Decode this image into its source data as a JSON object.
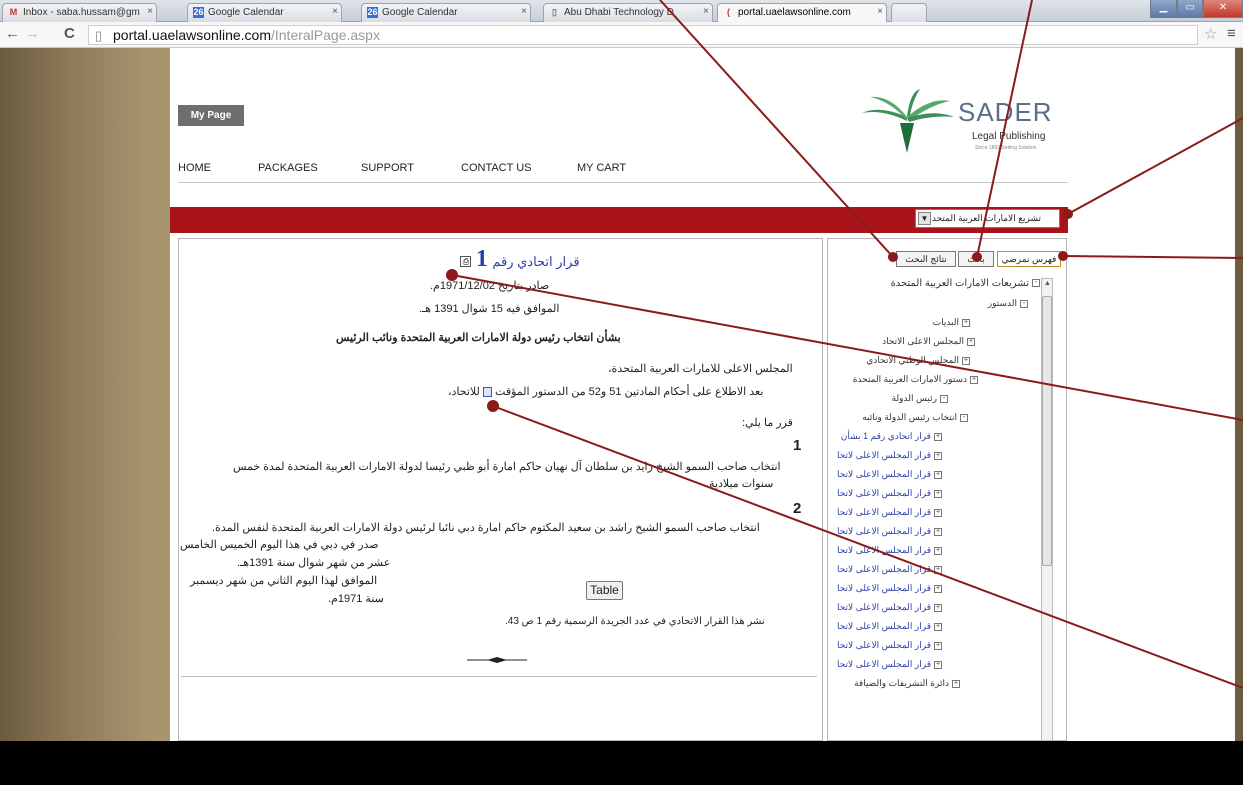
{
  "browser": {
    "tabs": [
      {
        "label": "Inbox - saba.hussam@gm",
        "icon": "gmail-icon"
      },
      {
        "label": "Google Calendar",
        "icon": "calendar-icon"
      },
      {
        "label": "Google Calendar",
        "icon": "calendar-icon"
      },
      {
        "label": "Abu Dhabi Technology D",
        "icon": "page-icon"
      },
      {
        "label": "portal.uaelawsonline.com",
        "icon": "loading-icon"
      }
    ],
    "address_host": "portal.uaelawsonline.com",
    "address_path": "/InteralPage.aspx"
  },
  "header": {
    "my_page": "My Page",
    "nav": [
      "HOME",
      "PACKAGES",
      "SUPPORT",
      "CONTACT US",
      "MY CART"
    ],
    "logo_name": "SADER",
    "logo_sub": "Legal Publishing",
    "logo_tag": "Since 1863 Setting Solution",
    "dropdown_value": "تشريع الامارات العربية المتحدة"
  },
  "document": {
    "title_prefix": "قرار اتحادي رقم",
    "title_number": "1",
    "issued_line": "صادر بتاريخ 1971/12/02م.",
    "hijri_line": "الموافق فيه 15 شوال 1391 هـ.",
    "subject": "بشأن انتخاب رئيس دولة الامارات العربية المتحدة ونائب الرئيس",
    "council": "المجلس الاعلى للامارات العربية المتحدة،",
    "after_review": "بعد الاطلاع على أحكام المادتين 51 و52 من الدستور المؤقت",
    "after_review_end": "للاتحاد،",
    "decided": "قرر ما يلي:",
    "art1_num": "1",
    "art1_text_a": "انتخاب صاحب السمو الشيخ زايد بن سلطان آل نهيان حاكم امارة أبو ظبي رئيسا لدولة الامارات العربية المتحدة لمدة خمس",
    "art1_text_b": "سنوات ميلادية.",
    "art2_num": "2",
    "art2_text": "انتخاب صاحب السمو الشيخ راشد بن سعيد المكتوم حاكم امارة دبي نائبا لرئيس دولة الامارات العربية المتحدة لنفس المدة.",
    "issued_dubai": [
      "صدر في دبي في هذا اليوم الخميس الخامس",
      "عشر من شهر شوال سنة 1391هـ.",
      "الموافق لهذا اليوم الثاني من شهر ديسمبر",
      "سنة 1971م."
    ],
    "table_button": "Table",
    "published": "نشر هذا القرار الاتحادي في عدد الجريدة الرسمية رقم 1 ص 43."
  },
  "sidebar": {
    "tabs": [
      "فهرس نمرضي",
      "بحث",
      "نتائج البحث"
    ],
    "tree": [
      {
        "label": "تشريعات الامارات العربية المتحدة",
        "sign": "-",
        "level": 0
      },
      {
        "label": "الدستور",
        "sign": "-",
        "level": 1
      },
      {
        "label": "البديات",
        "sign": "+",
        "level": 2
      },
      {
        "label": "المجلس الاعلى الاتحاد",
        "sign": "+",
        "level": 2
      },
      {
        "label": "المجلس الوطني الاتحادي",
        "sign": "+",
        "level": 2
      },
      {
        "label": "دستور الامارات العربية المتحدة",
        "sign": "+",
        "level": 2
      },
      {
        "label": "رئيس الدولة",
        "sign": "-",
        "level": 2
      },
      {
        "label": "انتخاب رئيس الدولة ونائبه",
        "sign": "-",
        "level": 3
      },
      {
        "label": "قرار اتحادي رقم 1 بشأن",
        "sign": "+",
        "level": 4,
        "selected": true
      },
      {
        "label": "قرار المجلس الاعلى لاتحا",
        "sign": "+",
        "level": 4
      },
      {
        "label": "قرار المجلس الاعلى لاتحا",
        "sign": "+",
        "level": 4
      },
      {
        "label": "قرار المجلس الاعلى لاتحا",
        "sign": "+",
        "level": 4
      },
      {
        "label": "قرار المجلس الاعلى لاتحا",
        "sign": "+",
        "level": 4
      },
      {
        "label": "قرار المجلس الاعلى لاتحا",
        "sign": "+",
        "level": 4
      },
      {
        "label": "قرار المجلس الاعلى لاتحا",
        "sign": "+",
        "level": 4
      },
      {
        "label": "قرار المجلس الاعلى لاتحا",
        "sign": "+",
        "level": 4
      },
      {
        "label": "قرار المجلس الاعلى لاتحا",
        "sign": "+",
        "level": 4
      },
      {
        "label": "قرار المجلس الاعلى لاتحا",
        "sign": "+",
        "level": 4
      },
      {
        "label": "قرار المجلس الاعلى لاتحا",
        "sign": "+",
        "level": 4
      },
      {
        "label": "قرار المجلس الاعلى لاتحا",
        "sign": "+",
        "level": 4
      },
      {
        "label": "قرار المجلس الاعلى لاتحا",
        "sign": "+",
        "level": 4
      },
      {
        "label": "دائرة التشريفات والضيافة",
        "sign": "+",
        "level": 2
      }
    ]
  },
  "colors": {
    "accent_red": "#a81419",
    "link_blue": "#2a3fa3",
    "annotation": "#8b1a1a"
  }
}
